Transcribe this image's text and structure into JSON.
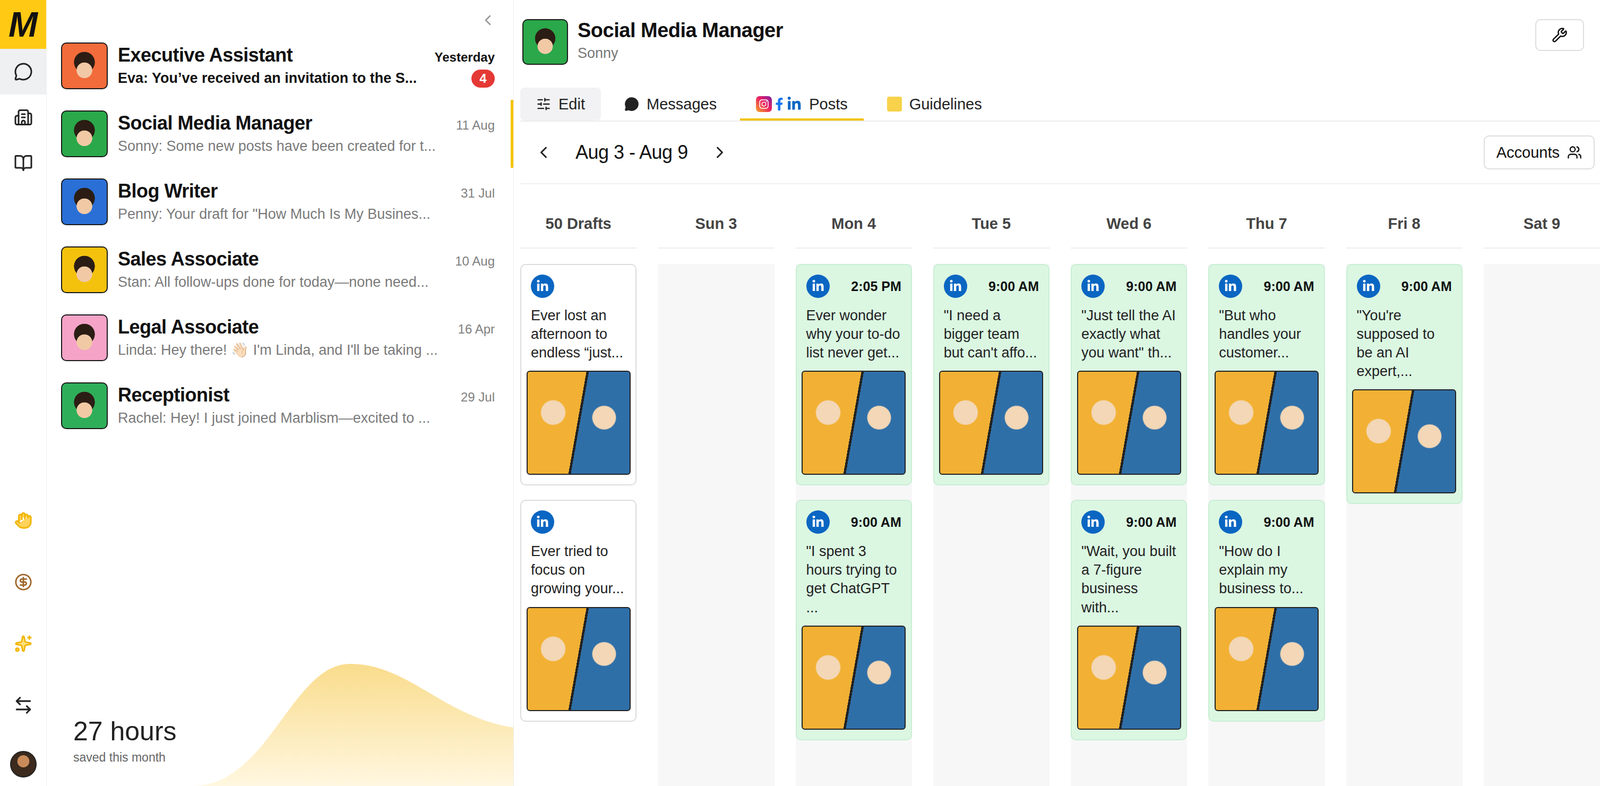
{
  "rail": {
    "logo": "M",
    "items": [
      {
        "selected": true
      },
      {
        "selected": false
      },
      {
        "selected": false
      }
    ]
  },
  "conversations": [
    {
      "title": "Executive Assistant",
      "date": "Yesterday",
      "preview": "Eva: You’ve received an invitation to the S...",
      "unread": true,
      "badge": "4",
      "selected": false,
      "color": "#f26b3a"
    },
    {
      "title": "Social Media Manager",
      "date": "11 Aug",
      "preview": "Sonny: Some new posts have been created for t...",
      "unread": false,
      "badge": "",
      "selected": true,
      "color": "#2aa84a"
    },
    {
      "title": "Blog Writer",
      "date": "31 Jul",
      "preview": "Penny: Your draft for \"How Much Is My Busines...",
      "unread": false,
      "badge": "",
      "selected": false,
      "color": "#2a6fd6"
    },
    {
      "title": "Sales Associate",
      "date": "10 Aug",
      "preview": "Stan: All follow-ups done for today—none need...",
      "unread": false,
      "badge": "",
      "selected": false,
      "color": "#f4c20d"
    },
    {
      "title": "Legal Associate",
      "date": "16 Apr",
      "preview": "Linda: Hey there! 👋🏻 I'm Linda, and I'll be taking ...",
      "unread": false,
      "badge": "",
      "selected": false,
      "color": "#f5a3c7"
    },
    {
      "title": "Receptionist",
      "date": "29 Jul",
      "preview": "Rachel: Hey! I just joined Marblism—excited to ...",
      "unread": false,
      "badge": "",
      "selected": false,
      "color": "#2fae5a"
    }
  ],
  "savings": {
    "value": "27 hours",
    "label": "saved this month"
  },
  "agent": {
    "title": "Social Media Manager",
    "name": "Sonny"
  },
  "tabs": [
    {
      "label": "Edit",
      "selected": false,
      "kind": "button"
    },
    {
      "label": "Messages",
      "selected": false,
      "kind": "tab"
    },
    {
      "label": "Posts",
      "selected": true,
      "kind": "tab"
    },
    {
      "label": "Guidelines",
      "selected": false,
      "kind": "tab"
    }
  ],
  "week": {
    "range": "Aug 3 - Aug 9",
    "accounts_button": "Accounts"
  },
  "drafts": {
    "label": "50 Drafts",
    "posts": [
      {
        "text": "Ever lost an afternoon to endless “just..."
      },
      {
        "text": "Ever tried to focus on growing your..."
      }
    ]
  },
  "days": [
    {
      "label": "Sun 3",
      "posts": []
    },
    {
      "label": "Mon 4",
      "posts": [
        {
          "time": "2:05 PM",
          "text": "Ever wonder why your to-do list never get..."
        },
        {
          "time": "9:00 AM",
          "text": "\"I spent 3 hours trying to get ChatGPT ..."
        }
      ]
    },
    {
      "label": "Tue 5",
      "posts": [
        {
          "time": "9:00 AM",
          "text": "\"I need a bigger team but can't affo..."
        }
      ]
    },
    {
      "label": "Wed 6",
      "posts": [
        {
          "time": "9:00 AM",
          "text": "\"Just tell the AI exactly what you want\" th..."
        },
        {
          "time": "9:00 AM",
          "text": "\"Wait, you built a 7-figure business with..."
        }
      ]
    },
    {
      "label": "Thu 7",
      "posts": [
        {
          "time": "9:00 AM",
          "text": "\"But who handles your customer..."
        },
        {
          "time": "9:00 AM",
          "text": "\"How do I explain my business to..."
        }
      ]
    },
    {
      "label": "Fri 8",
      "posts": [
        {
          "time": "9:00 AM",
          "text": "\"You're supposed to be an AI expert,..."
        }
      ]
    },
    {
      "label": "Sat 9",
      "posts": []
    }
  ]
}
